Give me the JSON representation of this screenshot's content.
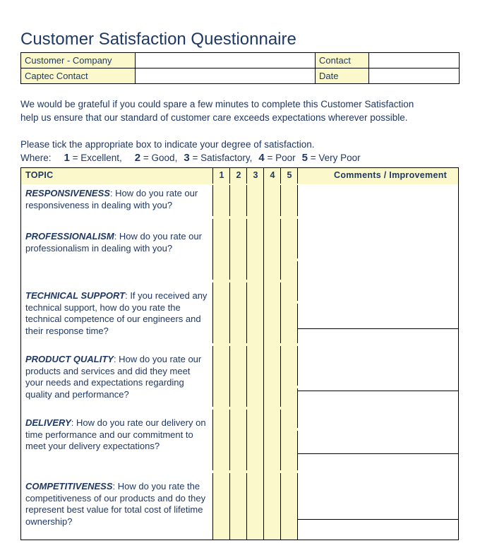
{
  "document": {
    "title": "Customer Satisfaction Questionnaire"
  },
  "contact_table": {
    "rows": [
      {
        "label": "Customer  - Company",
        "value": "",
        "label2": "Contact",
        "value2": ""
      },
      {
        "label": "Captec Contact",
        "value": "",
        "label2": "Date",
        "value2": ""
      }
    ]
  },
  "intro": {
    "paragraph1_line1": "We would be grateful if you could spare a few minutes to complete this Customer Satisfaction",
    "paragraph1_line2": "help us ensure that our standard of customer care exceeds expectations wherever possible.",
    "instruction": "Please tick the appropriate box to indicate your degree of satisfaction.",
    "where_label": "Where:",
    "scale": [
      {
        "num": "1",
        "text": "= Excellent,"
      },
      {
        "num": "2",
        "text": "= Good,"
      },
      {
        "num": "3",
        "text": "= Satisfactory,"
      },
      {
        "num": "4",
        "text": "= Poor"
      },
      {
        "num": "5",
        "text": "= Very Poor"
      }
    ]
  },
  "questionnaire": {
    "header": {
      "topic": "TOPIC",
      "ratings": [
        "1",
        "2",
        "3",
        "4",
        "5"
      ],
      "comments": "Comments / Improvement"
    },
    "questions": [
      {
        "name": "RESPONSIVENESS",
        "question": ": How do you rate our responsiveness in dealing with you?"
      },
      {
        "name": "PROFESSIONALISM",
        "question": ": How do you rate our professionalism in dealing with you?"
      },
      {
        "name": "TECHNICAL SUPPORT",
        "question": ": If you received any technical support, how do you rate the technical competence of our engineers and their response time?"
      },
      {
        "name": "PRODUCT QUALITY",
        "question": ": How do you rate our products and services and did they meet your needs and expectations regarding quality and performance?"
      },
      {
        "name": "DELIVERY",
        "question": ": How do you rate our delivery on time performance and our commitment to meet your delivery expectations?"
      },
      {
        "name": "COMPETITIVENESS",
        "question": ": How do you rate the competitiveness of our products and do they represent best value for total cost of lifetime ownership?"
      }
    ]
  },
  "colors": {
    "highlight": "#fbf8cc",
    "text": "#1f3864",
    "border": "#000000",
    "page": "#ffffff"
  }
}
